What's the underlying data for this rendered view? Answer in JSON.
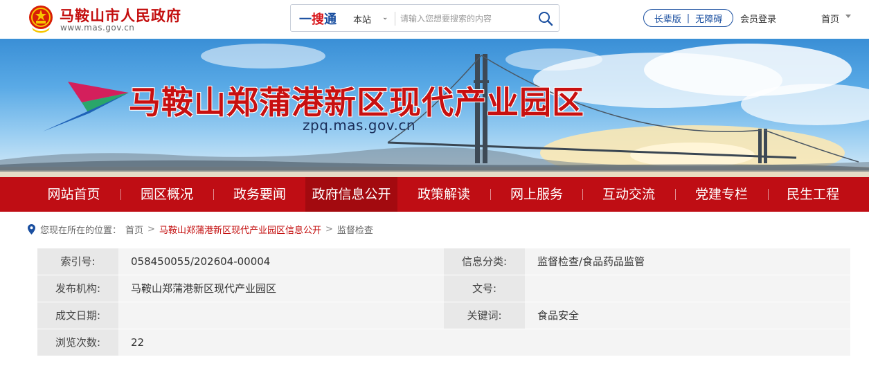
{
  "header": {
    "site_name": "马鞍山市人民政府",
    "site_url": "www.mas.gov.cn",
    "search": {
      "brand_prefix": "一",
      "brand_red": "搜",
      "brand_suffix": "通",
      "scope": "本站",
      "placeholder": "请输入您想要搜索的内容"
    },
    "accessibility": {
      "elder": "长辈版",
      "barrier_free": "无障碍"
    },
    "member_login": "会员登录",
    "home": "首页"
  },
  "banner": {
    "title": "马鞍山郑蒲港新区现代产业园区",
    "url": "zpq.mas.gov.cn"
  },
  "nav": {
    "items": [
      {
        "label": "网站首页"
      },
      {
        "label": "园区概况"
      },
      {
        "label": "政务要闻"
      },
      {
        "label": "政府信息公开"
      },
      {
        "label": "政策解读"
      },
      {
        "label": "网上服务"
      },
      {
        "label": "互动交流"
      },
      {
        "label": "党建专栏"
      },
      {
        "label": "民生工程"
      }
    ],
    "active_index": 3
  },
  "breadcrumb": {
    "prefix": "您现在所在的位置：",
    "home": "首页",
    "section": "马鞍山郑蒲港新区现代产业园区信息公开",
    "current": "监督检查"
  },
  "info": {
    "index_label": "索引号:",
    "index_value": "058450055/202604-00004",
    "category_label": "信息分类:",
    "category_value": "监督检查/食品药品监管",
    "publisher_label": "发布机构:",
    "publisher_value": "马鞍山郑蒲港新区现代产业园区",
    "docno_label": "文号:",
    "docno_value": "",
    "date_label": "成文日期:",
    "date_value": "",
    "keywords_label": "关键词:",
    "keywords_value": "食品安全",
    "views_label": "浏览次数:",
    "views_value": "22"
  },
  "colors": {
    "brand_red": "#c30d0d",
    "nav_red": "#bf0d14",
    "nav_active": "#a30a0f",
    "link_blue": "#1a4fa0"
  }
}
